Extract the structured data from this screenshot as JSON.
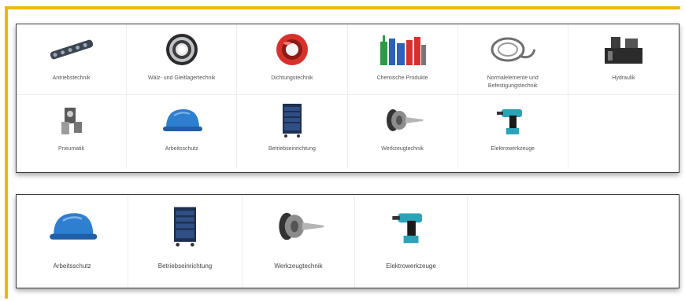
{
  "top_panel": {
    "tiles": [
      {
        "label": "Antriebstechnik",
        "icon": "chain-icon"
      },
      {
        "label": "Wälz- und Gleitlagertechnik",
        "icon": "bearing-icon"
      },
      {
        "label": "Dichtungstechnik",
        "icon": "seal-ring-icon"
      },
      {
        "label": "Chemische Produkte",
        "icon": "chemical-bottles-icon"
      },
      {
        "label": "Normalelemente und Befestigungstechnik",
        "icon": "cable-loop-icon"
      },
      {
        "label": "Hydraulik",
        "icon": "hydraulic-unit-icon"
      },
      {
        "label": "Pneumatik",
        "icon": "pneumatic-valve-icon"
      },
      {
        "label": "Arbeitsschutz",
        "icon": "hard-hat-icon"
      },
      {
        "label": "Betriebseinrichtung",
        "icon": "tool-cabinet-icon"
      },
      {
        "label": "Werkzeugtechnik",
        "icon": "tool-holder-icon"
      },
      {
        "label": "Elektrowerkzeuge",
        "icon": "power-drill-icon"
      }
    ]
  },
  "bottom_panel": {
    "tiles": [
      {
        "label": "Arbeitsschutz",
        "icon": "hard-hat-icon"
      },
      {
        "label": "Betriebseinrichtung",
        "icon": "tool-cabinet-icon"
      },
      {
        "label": "Werkzeugtechnik",
        "icon": "tool-holder-icon"
      },
      {
        "label": "Elektrowerkzeuge",
        "icon": "power-drill-icon"
      }
    ]
  },
  "colors": {
    "frame_accent": "#f2b705",
    "helmet_blue": "#2f7fd0",
    "seal_red": "#d8312b",
    "drill_teal": "#2aa3b8"
  }
}
